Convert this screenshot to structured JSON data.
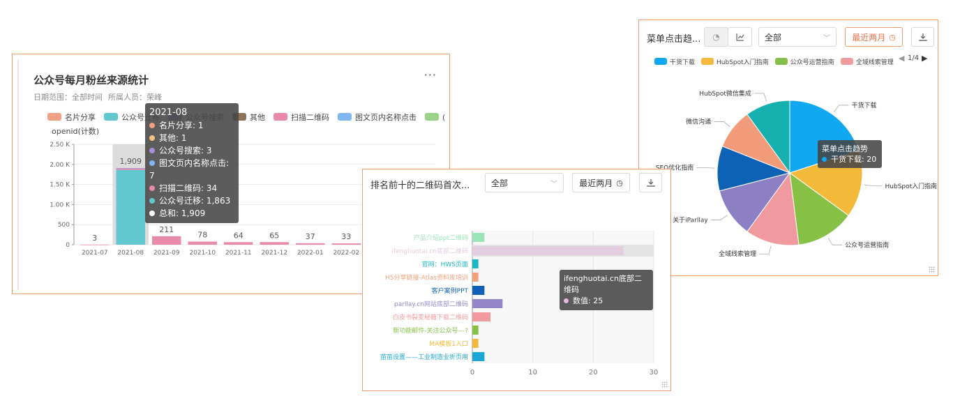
{
  "card1": {
    "title": "公众号每月粉丝来源统计",
    "more_label": "···",
    "filter_date": "日期范围：全部时间",
    "filter_owner": "所属人员：荣峰",
    "legend": [
      {
        "name": "名片分享",
        "color": "#f0a085"
      },
      {
        "name": "公众号迁移",
        "color": "#62c8cf"
      },
      {
        "name": "公众号搜索",
        "color": "#a68fd8"
      },
      {
        "name": "其他",
        "color": "#8e7359"
      },
      {
        "name": "扫描二维码",
        "color": "#e78aac"
      },
      {
        "name": "图文页内名称点击",
        "color": "#80b7f2"
      },
      {
        "name": "(空)",
        "color": "#9bd28a"
      }
    ],
    "ylabel": "openid(计数)",
    "tooltip": {
      "title": "2021-08",
      "rows": [
        {
          "label": "名片分享: 1",
          "color": "#f0a085"
        },
        {
          "label": "其他: 1",
          "color": "#f6c37d"
        },
        {
          "label": "公众号搜索: 3",
          "color": "#a68fd8"
        },
        {
          "label": "图文页内名称点击: 7",
          "color": "#80b7f2"
        },
        {
          "label": "扫描二维码: 34",
          "color": "#e78aac"
        },
        {
          "label": "公众号迁移: 1,863",
          "color": "#62c8cf"
        },
        {
          "label": "总和: 1,909",
          "color": "#ffffff"
        }
      ]
    }
  },
  "card2": {
    "title": "排名前十的二维码首次...",
    "select_value": "全部",
    "range_label": "最近两月",
    "tooltip": {
      "title": "ifenghuotai.cn底部二维码",
      "row": "数值: 25",
      "color": "#e9b6e6"
    }
  },
  "card3": {
    "title": "菜单点击趋...",
    "select_value": "全部",
    "range_label": "最近两月",
    "pager": "1/4",
    "legend": [
      {
        "name": "干货下载",
        "color": "#0fa7f0"
      },
      {
        "name": "HubSpot入门指南",
        "color": "#f2b93b"
      },
      {
        "name": "公众号运营指南",
        "color": "#86c045"
      },
      {
        "name": "全域线索管理",
        "color": "#f09aa0"
      }
    ],
    "tooltip": {
      "title": "菜单点击趋势",
      "row": "干货下载: 20",
      "color": "#0fa7f0"
    }
  },
  "chart_data": [
    {
      "type": "bar",
      "title": "公众号每月粉丝来源统计",
      "ylabel": "openid(计数)",
      "ylim": [
        0,
        2500
      ],
      "yticks": [
        "0",
        "500",
        "1.00 K",
        "1.50 K",
        "2.00 K",
        "2.50 K"
      ],
      "categories": [
        "2021-07",
        "2021-08",
        "2021-09",
        "2021-10",
        "2021-11",
        "2021-12",
        "2022-01",
        "2022-02"
      ],
      "totals": [
        3,
        1909,
        211,
        78,
        64,
        65,
        37,
        33
      ],
      "total_labels": [
        "3",
        "1,909",
        "211",
        "78",
        "64",
        "65",
        "37",
        "33"
      ],
      "series": [
        {
          "name": "公众号迁移",
          "values": [
            0,
            1863,
            0,
            0,
            0,
            0,
            0,
            0
          ],
          "color": "#62c8cf"
        },
        {
          "name": "扫描二维码",
          "values": [
            3,
            34,
            211,
            78,
            64,
            65,
            37,
            33
          ],
          "color": "#e78aac"
        },
        {
          "name": "其他",
          "values": [
            0,
            12,
            0,
            0,
            0,
            0,
            0,
            0
          ],
          "color": "#a68fd8"
        }
      ],
      "highlight_category": "2021-08",
      "grid": true
    },
    {
      "type": "bar",
      "orientation": "horizontal",
      "title": "排名前十的二维码首次...",
      "xlim": [
        0,
        30
      ],
      "xticks": [
        0,
        10,
        20,
        30
      ],
      "categories": [
        "产品介绍ppt二维码",
        "ifenghuotai.cn底部二维码",
        "官网：HWS页面",
        "H5分享链接-Atlas资料库培训",
        "客户案例PPT",
        "parllay.cn网站底部二维码",
        "白皮书裂变秘籍下载二维码",
        "新功能邮件-关注公众号---?",
        "MA模板1入口",
        "苗苗设置——工业制造业折页用"
      ],
      "values": [
        2,
        25,
        1,
        1,
        2,
        5,
        3,
        1,
        1,
        2
      ],
      "colors": [
        "#9de3b9",
        "#e2cde0",
        "#1bb8c4",
        "#f3a17b",
        "#1160b8",
        "#9586c8",
        "#f09aa0",
        "#86c045",
        "#f2b93b",
        "#1ba7d6"
      ],
      "highlight_category": "ifenghuotai.cn底部二维码"
    },
    {
      "type": "pie",
      "title": "菜单点击趋势",
      "labels": [
        "干货下载",
        "HubSpot入门指南",
        "公众号运营指南",
        "全域线索管理",
        "关于iParllay",
        "SEO优化指南",
        "微信沟通",
        "HubSpot微信集成"
      ],
      "values": [
        20,
        15,
        13,
        12,
        11,
        10,
        9,
        10
      ],
      "colors": [
        "#0fa7f0",
        "#f2b93b",
        "#86c045",
        "#f09aa0",
        "#8d7fc4",
        "#0e62b5",
        "#f29b7a",
        "#16b0ae"
      ]
    }
  ]
}
